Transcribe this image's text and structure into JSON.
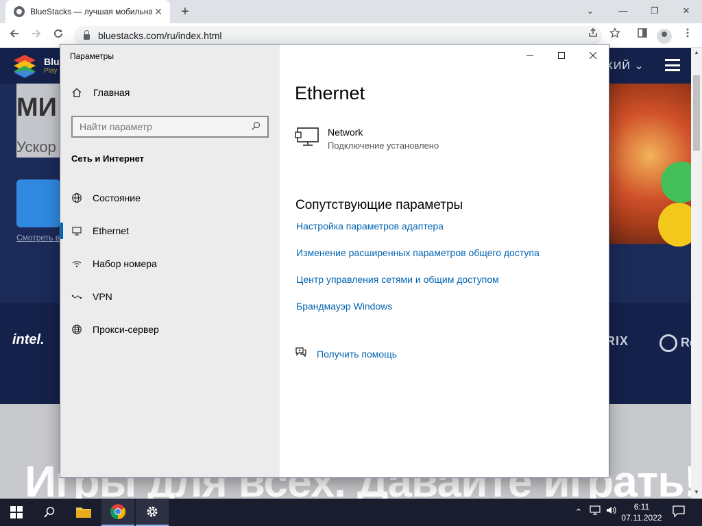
{
  "browser": {
    "tab_title": "BlueStacks — лучшая мобильна",
    "tab_close": "✕",
    "new_tab": "+",
    "url": "bluestacks.com/ru/index.html",
    "window_controls": {
      "minimize": "⌄",
      "min2": "—",
      "restore": "❐",
      "close": "✕"
    }
  },
  "page": {
    "brand_name": "Blue",
    "brand_sub": "Play B",
    "language": "СКИЙ",
    "hero_heading": "МИ",
    "hero_sub": "Ускор",
    "app_link": "Смотреть в",
    "partner_intel": "intel.",
    "partner_rix": "RIX",
    "partner_ro": "Re",
    "big_slogan": "Игры для всех. Давайте играть!"
  },
  "settings": {
    "title": "Параметры",
    "home": "Главная",
    "search_placeholder": "Найти параметр",
    "section": "Сеть и Интернет",
    "nav": [
      {
        "label": "Состояние",
        "icon": "globe-status-icon"
      },
      {
        "label": "Ethernet",
        "icon": "ethernet-icon"
      },
      {
        "label": "Набор номера",
        "icon": "dialup-icon"
      },
      {
        "label": "VPN",
        "icon": "vpn-icon"
      },
      {
        "label": "Прокси-сервер",
        "icon": "globe-icon"
      }
    ],
    "active_index": 1,
    "page_title": "Ethernet",
    "network_name": "Network",
    "network_status": "Подключение установлено",
    "related_heading": "Сопутствующие параметры",
    "links": [
      "Настройка параметров адаптера",
      "Изменение расширенных параметров общего доступа",
      "Центр управления сетями и общим доступом",
      "Брандмауэр Windows"
    ],
    "help": "Получить помощь"
  },
  "taskbar": {
    "time": "6:11",
    "date": "07.11.2022"
  },
  "colors": {
    "link": "#0063b1",
    "accent": "#0067c0",
    "page_bg": "#1c2a58"
  }
}
